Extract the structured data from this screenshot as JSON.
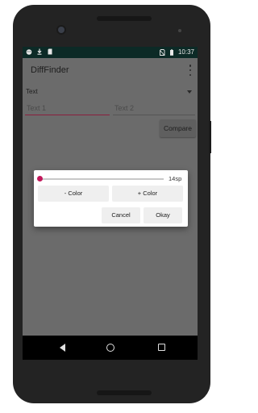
{
  "status_bar": {
    "time": "10:37",
    "left_icons": [
      "android-icon",
      "download-icon",
      "sd-card-icon"
    ],
    "right_icons": [
      "no-sim-icon",
      "battery-icon"
    ]
  },
  "app_bar": {
    "title": "DiffFinder",
    "overflow_icon": "overflow-menu-icon"
  },
  "spinner": {
    "selected": "Text"
  },
  "inputs": {
    "text1": {
      "placeholder": "Text 1",
      "value": ""
    },
    "text2": {
      "placeholder": "Text 2",
      "value": ""
    }
  },
  "compare_button": {
    "label": "Compare"
  },
  "dialog": {
    "slider": {
      "value_fraction": 0.0,
      "label": "14sp"
    },
    "minus_color_label": "- Color",
    "plus_color_label": "+ Color",
    "cancel_label": "Cancel",
    "okay_label": "Okay"
  },
  "colors": {
    "status_bar": "#0c2a26",
    "accent": "#c2185b",
    "focused_underline": "#8a1f3d",
    "dim_background": "#6b6b6b"
  },
  "nav_bar": {
    "icons": [
      "back-icon",
      "home-icon",
      "recents-icon"
    ]
  }
}
